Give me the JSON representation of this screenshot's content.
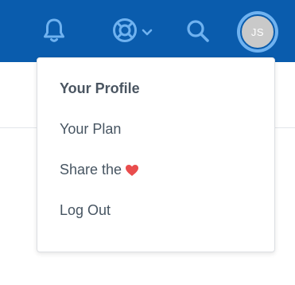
{
  "colors": {
    "topbar": "#0A5CAD",
    "icon": "#6fb2f0",
    "menu_text": "#475562",
    "heart": "#e94d4d"
  },
  "header": {
    "icons": [
      "bell-icon",
      "lifebuoy-icon",
      "chevron-down-icon",
      "search-icon"
    ],
    "avatar_initials": "JS"
  },
  "menu": {
    "items": [
      {
        "label": "Your Profile",
        "bold": true
      },
      {
        "label": "Your Plan"
      },
      {
        "label": "Share the",
        "icon": "heart-icon"
      },
      {
        "label": "Log Out"
      }
    ]
  }
}
